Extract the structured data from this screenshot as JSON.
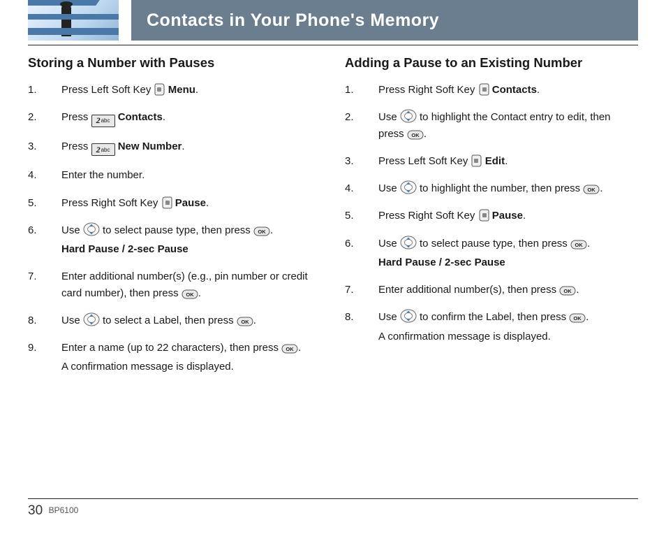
{
  "header": {
    "title": "Contacts in Your Phone's Memory"
  },
  "left": {
    "heading": "Storing a Number with Pauses",
    "steps": [
      {
        "pre": "Press Left Soft Key ",
        "icon": "soft-left",
        "post": " ",
        "bold": "Menu",
        "tail": "."
      },
      {
        "pre": "Press ",
        "icon": "key-2abc",
        "post": " ",
        "bold": "Contacts",
        "tail": "."
      },
      {
        "pre": "Press ",
        "icon": "key-2abc",
        "post": " ",
        "bold": "New Number",
        "tail": "."
      },
      {
        "pre": "Enter the number."
      },
      {
        "pre": "Press Right Soft Key ",
        "icon": "soft-right",
        "post": " ",
        "bold": "Pause",
        "tail": "."
      },
      {
        "pre": "Use ",
        "icon": "nav",
        "post": " to select pause type, then press ",
        "icon2": "ok",
        "tail": ".",
        "sub": "Hard Pause / 2-sec Pause"
      },
      {
        "pre": "Enter additional number(s) (e.g., pin number or credit card number), then press ",
        "icon": "ok",
        "tail": "."
      },
      {
        "pre": "Use ",
        "icon": "nav",
        "post": " to select a Label, then press ",
        "icon2": "ok",
        "tail": "."
      },
      {
        "pre": "Enter a name (up to 22 characters), then press ",
        "icon": "ok",
        "tail": ".",
        "plainsub": "A confirmation message is displayed."
      }
    ]
  },
  "right": {
    "heading": "Adding a Pause to an Existing Number",
    "steps": [
      {
        "pre": "Press Right Soft Key ",
        "icon": "soft-right",
        "post": " ",
        "bold": "Contacts",
        "tail": "."
      },
      {
        "pre": "Use ",
        "icon": "nav",
        "post": " to highlight the Contact entry to edit, then press ",
        "icon2": "ok",
        "tail": "."
      },
      {
        "pre": "Press Left Soft Key ",
        "icon": "soft-left",
        "post": " ",
        "bold": "Edit",
        "tail": "."
      },
      {
        "pre": "Use ",
        "icon": "nav",
        "post": " to highlight the number, then press ",
        "icon2": "ok",
        "tail": "."
      },
      {
        "pre": "Press Right Soft Key ",
        "icon": "soft-right",
        "post": " ",
        "bold": "Pause",
        "tail": "."
      },
      {
        "pre": "Use ",
        "icon": "nav",
        "post": " to select pause type, then press ",
        "icon2": "ok",
        "tail": ".",
        "sub": "Hard Pause / 2-sec Pause"
      },
      {
        "pre": "Enter additional number(s), then press ",
        "icon": "ok",
        "tail": "."
      },
      {
        "pre": "Use ",
        "icon": "nav",
        "post": " to confirm the Label, then press ",
        "icon2": "ok",
        "tail": ".",
        "plainsub": "A confirmation message is displayed."
      }
    ]
  },
  "footer": {
    "page": "30",
    "model": "BP6100"
  },
  "icons": {
    "soft-left": "left-softkey-icon",
    "soft-right": "right-softkey-icon",
    "key-2abc": "keypad-2abc-icon",
    "nav": "nav-updown-icon",
    "ok": "ok-key-icon"
  }
}
